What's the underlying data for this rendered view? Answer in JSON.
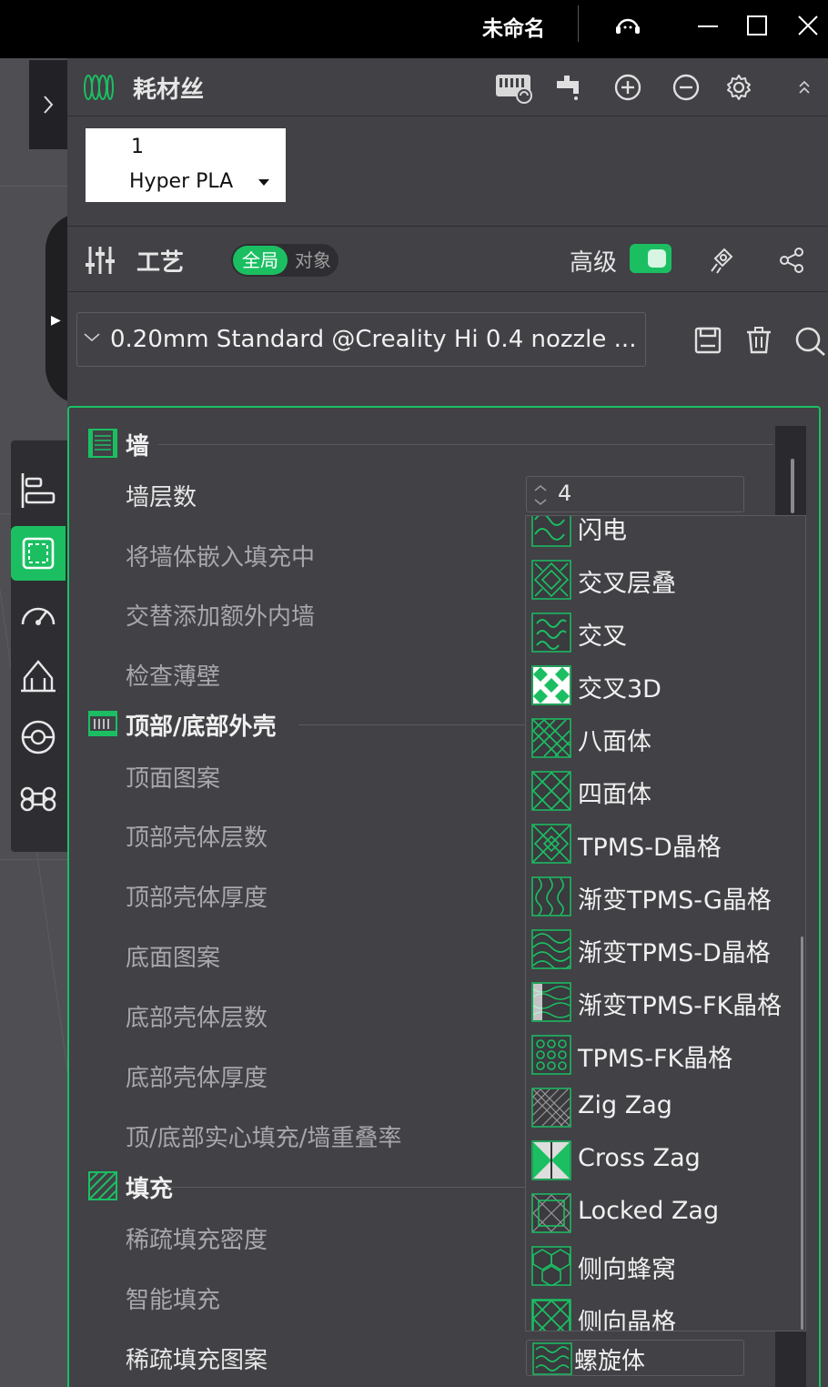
{
  "window": {
    "title": "未命名"
  },
  "filament": {
    "label": "耗材丝",
    "slot_number": "1",
    "material": "Hyper PLA"
  },
  "process": {
    "label": "工艺",
    "scope_on": "全局",
    "scope_off": "对象",
    "advanced_label": "高级",
    "preset": "0.20mm Standard @Creality Hi 0.4 nozzle ..."
  },
  "sections": {
    "wall": {
      "title": "墙",
      "rows": [
        "墙层数",
        "将墙体嵌入填充中",
        "交替添加额外内墙",
        "检查薄壁"
      ],
      "wall_count": "4"
    },
    "shell": {
      "title": "顶部/底部外壳",
      "rows": [
        "顶面图案",
        "顶部壳体层数",
        "顶部壳体厚度",
        "底面图案",
        "底部壳体层数",
        "底部壳体厚度",
        "顶/底部实心填充/墙重叠率"
      ]
    },
    "infill": {
      "title": "填充",
      "rows": [
        "稀疏填充密度",
        "智能填充",
        "稀疏填充图案"
      ],
      "pattern_selected": "螺旋体"
    }
  },
  "dropdown": {
    "items": [
      {
        "label": "闪电",
        "icon": "lightning-pattern-icon"
      },
      {
        "label": "交叉层叠",
        "icon": "cross-hatch-pattern-icon"
      },
      {
        "label": "交叉",
        "icon": "cross-pattern-icon"
      },
      {
        "label": "交叉3D",
        "icon": "cross-3d-pattern-icon"
      },
      {
        "label": "八面体",
        "icon": "octahedral-pattern-icon"
      },
      {
        "label": "四面体",
        "icon": "tetrahedral-pattern-icon"
      },
      {
        "label": "TPMS-D晶格",
        "icon": "tpms-d-pattern-icon"
      },
      {
        "label": "渐变TPMS-G晶格",
        "icon": "gradient-tpms-g-pattern-icon"
      },
      {
        "label": "渐变TPMS-D晶格",
        "icon": "gradient-tpms-d-pattern-icon"
      },
      {
        "label": "渐变TPMS-FK晶格",
        "icon": "gradient-tpms-fk-pattern-icon"
      },
      {
        "label": "TPMS-FK晶格",
        "icon": "tpms-fk-pattern-icon"
      },
      {
        "label": "Zig Zag",
        "icon": "zig-zag-pattern-icon"
      },
      {
        "label": "Cross Zag",
        "icon": "cross-zag-pattern-icon"
      },
      {
        "label": "Locked Zag",
        "icon": "locked-zag-pattern-icon"
      },
      {
        "label": "侧向蜂窝",
        "icon": "lateral-honeycomb-pattern-icon"
      },
      {
        "label": "侧向晶格",
        "icon": "lateral-lattice-pattern-icon"
      }
    ]
  },
  "colors": {
    "accent": "#1bbf62",
    "panel": "#414146",
    "titlebar": "#000000"
  }
}
